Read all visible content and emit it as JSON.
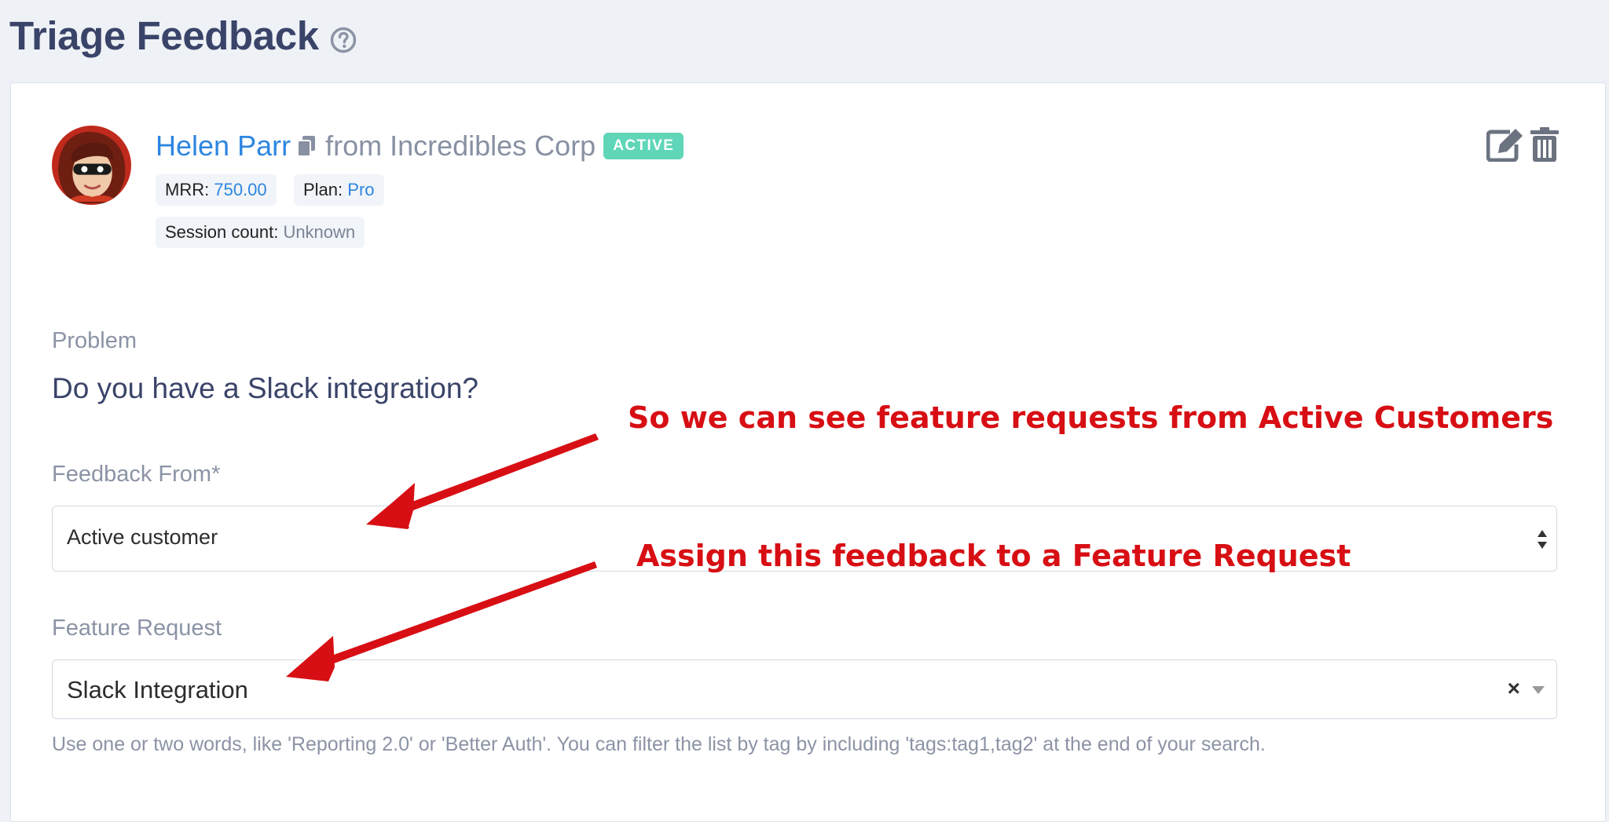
{
  "page": {
    "title": "Triage Feedback"
  },
  "customer": {
    "name": "Helen Parr",
    "company": "from Incredibles Corp",
    "status": "ACTIVE",
    "mrr_label": "MRR:",
    "mrr_value": "750.00",
    "plan_label": "Plan:",
    "plan_value": "Pro",
    "session_label": "Session count:",
    "session_value": "Unknown"
  },
  "problem": {
    "label": "Problem",
    "text": "Do you have a Slack integration?"
  },
  "feedback_from": {
    "label": "Feedback From*",
    "value": "Active customer"
  },
  "feature_request": {
    "label": "Feature Request",
    "value": "Slack Integration",
    "clear_symbol": "×",
    "help": "Use one or two words, like 'Reporting 2.0' or 'Better Auth'. You can filter the list by tag by including 'tags:tag1,tag2' at the end of your search."
  },
  "annotations": {
    "first": "So we can see feature requests from Active Customers",
    "second": "Assign this feedback to a Feature Request"
  },
  "colors": {
    "link": "#2d86e1",
    "badge": "#5fd6b8",
    "annotation": "#d70f14",
    "title": "#3a4469"
  },
  "icons": [
    "help-icon",
    "copy-icon",
    "edit-icon",
    "trash-icon",
    "sort-icon",
    "clear-icon",
    "chevron-down-icon"
  ]
}
